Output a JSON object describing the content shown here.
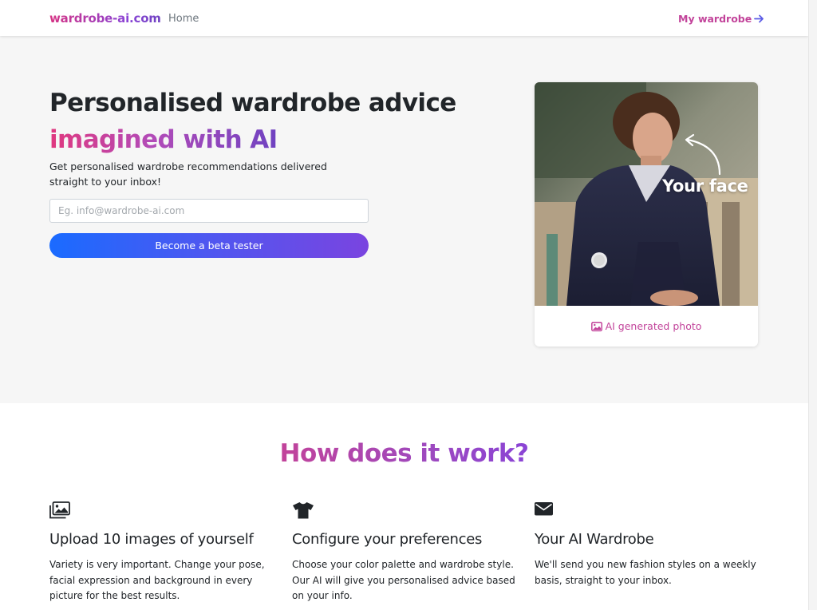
{
  "nav": {
    "brand": "wardrobe-ai.com",
    "home": "Home",
    "my_wardrobe": "My wardrobe",
    "my_wardrobe_icon": "arrow-right-icon"
  },
  "hero": {
    "title": "Personalised wardrobe advice",
    "title_gradient": "imagined with AI",
    "subtitle": "Get personalised wardrobe recommendations delivered straight to your inbox!",
    "email_placeholder": "Eg. info@wardrobe-ai.com",
    "email_value": "",
    "cta": "Become a beta tester",
    "photo_overlay": "Your face",
    "photo_caption": "AI generated photo",
    "photo_caption_icon": "image-icon"
  },
  "how": {
    "title": "How does it work?",
    "features": [
      {
        "icon": "images-icon",
        "title": "Upload 10 images of yourself",
        "text": "Variety is very important. Change your pose, facial expression and background in every picture for the best results."
      },
      {
        "icon": "tshirt-icon",
        "title": "Configure your preferences",
        "text": "Choose your color palette and wardrobe style. Our AI will give you personalised advice based on your info."
      },
      {
        "icon": "envelope-icon",
        "title": "Your AI Wardrobe",
        "text": "We'll send you new fashion styles on a weekly basis, straight to your inbox."
      }
    ]
  },
  "colors": {
    "brand_pink": "#d63384",
    "brand_purple": "#6f42c1",
    "button_blue": "#1a6bff",
    "hero_bg": "#f6f6f6"
  }
}
